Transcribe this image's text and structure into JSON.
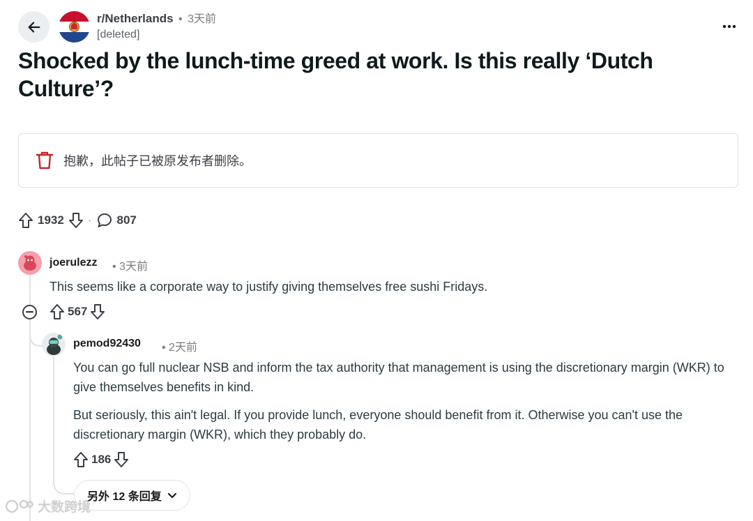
{
  "header": {
    "subreddit": "r/Netherlands",
    "separator": "•",
    "time": "3天前",
    "author": "[deleted]"
  },
  "post": {
    "title": "Shocked by the lunch-time greed at work. Is this really ‘Dutch Culture’?",
    "deleted_notice": "抱歉，此帖子已被原发布者删除。",
    "upvotes": "1932",
    "separator": "·",
    "comments": "807"
  },
  "comments": [
    {
      "user": "joerulezz",
      "time": "• 3天前",
      "body": "This seems like a corporate way to justify giving themselves free sushi Fridays.",
      "votes": "567"
    },
    {
      "user": "pemod92430",
      "time": "• 2天前",
      "body_p1": "You can go full nuclear NSB and inform the tax authority that management is using the discretionary margin (WKR) to give themselves benefits in kind.",
      "body_p2": "But seriously, this ain't legal. If you provide lunch, everyone should benefit from it. Otherwise you can't use the discretionary margin (WKR), which they probably do.",
      "votes": "186"
    }
  ],
  "more_replies": "另外 12 条回复",
  "watermark": "大数跨境",
  "icons": {
    "back": "arrow-left-icon",
    "more": "more-horizontal-icon",
    "trash": "trash-icon",
    "upvote": "arrow-up-icon",
    "downvote": "arrow-down-icon",
    "comment": "comment-bubble-icon",
    "collapse": "minus-circle-icon",
    "chevron": "chevron-down-icon"
  },
  "colors": {
    "trash": "#c0282d",
    "flag_red": "#c8102e",
    "flag_blue": "#21468b"
  }
}
